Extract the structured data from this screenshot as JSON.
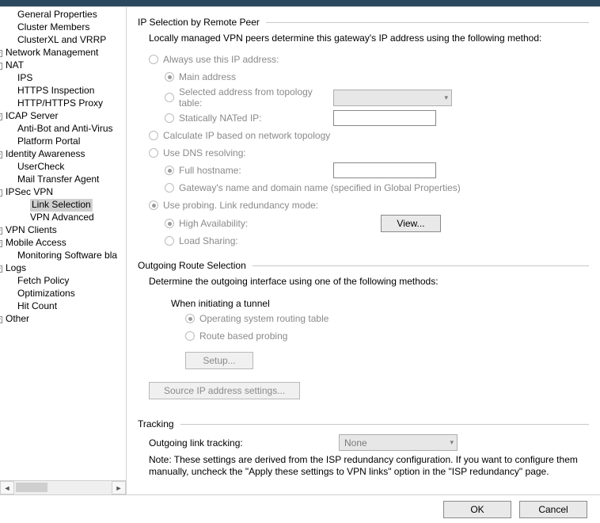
{
  "tree": [
    {
      "level": 1,
      "label": "General Properties"
    },
    {
      "level": 1,
      "label": "Cluster Members"
    },
    {
      "level": 1,
      "label": "ClusterXL and VRRP"
    },
    {
      "level": 0,
      "exp": "+",
      "label": "Network Management"
    },
    {
      "level": 0,
      "exp": "-",
      "label": "NAT"
    },
    {
      "level": 1,
      "label": "IPS"
    },
    {
      "level": 1,
      "label": "HTTPS Inspection"
    },
    {
      "level": 1,
      "label": "HTTP/HTTPS Proxy"
    },
    {
      "level": 0,
      "exp": "+",
      "label": "ICAP Server"
    },
    {
      "level": 1,
      "label": "Anti-Bot and Anti-Virus"
    },
    {
      "level": 1,
      "label": "Platform Portal"
    },
    {
      "level": 0,
      "exp": "+",
      "label": "Identity Awareness"
    },
    {
      "level": 1,
      "label": "UserCheck"
    },
    {
      "level": 1,
      "label": "Mail Transfer Agent"
    },
    {
      "level": 0,
      "exp": "-",
      "label": "IPSec VPN"
    },
    {
      "level": 2,
      "label": "Link Selection",
      "selected": true
    },
    {
      "level": 2,
      "label": "VPN Advanced"
    },
    {
      "level": 0,
      "exp": "+",
      "label": "VPN Clients"
    },
    {
      "level": 0,
      "exp": "+",
      "label": "Mobile Access"
    },
    {
      "level": 1,
      "label": "Monitoring Software bla"
    },
    {
      "level": 0,
      "exp": "+",
      "label": "Logs"
    },
    {
      "level": 1,
      "label": "Fetch Policy"
    },
    {
      "level": 1,
      "label": "Optimizations"
    },
    {
      "level": 1,
      "label": "Hit Count"
    },
    {
      "level": 0,
      "exp": "+",
      "label": "Other"
    }
  ],
  "ip_section": {
    "title": "IP Selection by Remote Peer",
    "desc": "Locally managed VPN peers determine this gateway's IP address using the following method:",
    "always_use": "Always use this IP address:",
    "main_address": "Main address",
    "selected_topology": "Selected address from topology table:",
    "statically_nated": "Statically NATed IP:",
    "calc_topology": "Calculate IP based on network topology",
    "use_dns": "Use DNS resolving:",
    "full_hostname": "Full hostname:",
    "gateway_name": "Gateway's name and domain name (specified in Global Properties)",
    "use_probing": "Use probing. Link redundancy mode:",
    "high_avail": "High Availability:",
    "load_sharing": "Load Sharing:",
    "view_btn": "View..."
  },
  "outgoing": {
    "title": "Outgoing Route Selection",
    "desc": "Determine the outgoing interface using one of the following methods:",
    "when_initiating": "When initiating a tunnel",
    "os_routing": "Operating system routing table",
    "route_probing": "Route based probing",
    "setup_btn": "Setup...",
    "source_btn": "Source IP address settings..."
  },
  "tracking": {
    "title": "Tracking",
    "outgoing_link": "Outgoing link tracking:",
    "dropdown_value": "None",
    "note": "Note: These settings are derived from the ISP redundancy configuration. If you want to configure them manually, uncheck the \"Apply these settings to VPN links\" option in the \"ISP redundancy\" page."
  },
  "footer": {
    "ok": "OK",
    "cancel": "Cancel"
  }
}
